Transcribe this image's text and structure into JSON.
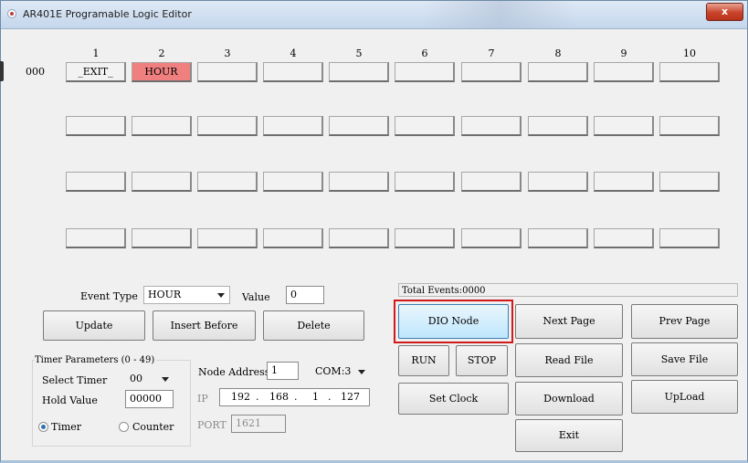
{
  "window": {
    "title": "AR401E Programable Logic Editor",
    "close_label": "x"
  },
  "grid": {
    "row_label": "000",
    "columns": [
      "1",
      "2",
      "3",
      "4",
      "5",
      "6",
      "7",
      "8",
      "9",
      "10"
    ],
    "row1": [
      "_EXIT_",
      "HOUR",
      "",
      "",
      "",
      "",
      "",
      "",
      "",
      ""
    ],
    "selected_cell_color": "#f08080"
  },
  "event": {
    "type_label": "Event Type",
    "type_value": "HOUR",
    "value_label": "Value",
    "value": "0",
    "total_events": "Total Events:0000"
  },
  "buttons": {
    "update": "Update",
    "insert_before": "Insert Before",
    "delete": "Delete",
    "dio_node": "DIO Node",
    "next_page": "Next Page",
    "prev_page": "Prev Page",
    "run": "RUN",
    "stop": "STOP",
    "read_file": "Read File",
    "save_file": "Save File",
    "set_clock": "Set Clock",
    "download": "Download",
    "upload": "UpLoad",
    "exit": "Exit"
  },
  "timer": {
    "group_label": "Timer Parameters (0 - 49)",
    "select_label": "Select Timer",
    "select_value": "00",
    "hold_label": "Hold Value",
    "hold_value": "00000",
    "radio_timer": "Timer",
    "radio_counter": "Counter"
  },
  "node": {
    "address_label": "Node Address",
    "address_value": "1",
    "com_value": "COM:3",
    "ip_label": "IP",
    "ip": [
      "192",
      "168",
      "1",
      "127"
    ],
    "port_label": "PORT",
    "port_value": "1621"
  },
  "highlight_color": "#d11a1a"
}
